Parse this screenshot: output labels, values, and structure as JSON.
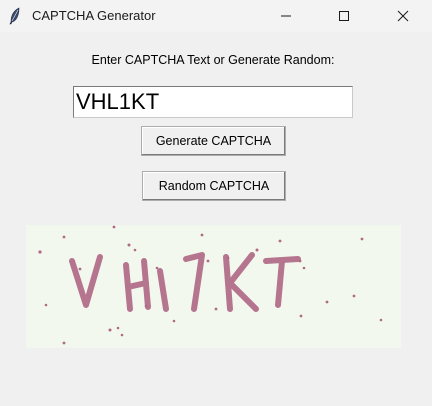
{
  "window": {
    "title": "CAPTCHA Generator",
    "icon": "feather-icon"
  },
  "form": {
    "prompt_label": "Enter CAPTCHA Text or Generate Random:",
    "entry_value": "VHL1KT",
    "generate_button": "Generate CAPTCHA",
    "random_button": "Random CAPTCHA"
  },
  "captcha": {
    "text": "VHL1KT",
    "background_color": "#f3f8ef",
    "text_color": "#b06a86",
    "dot_color": "#b06a86"
  }
}
